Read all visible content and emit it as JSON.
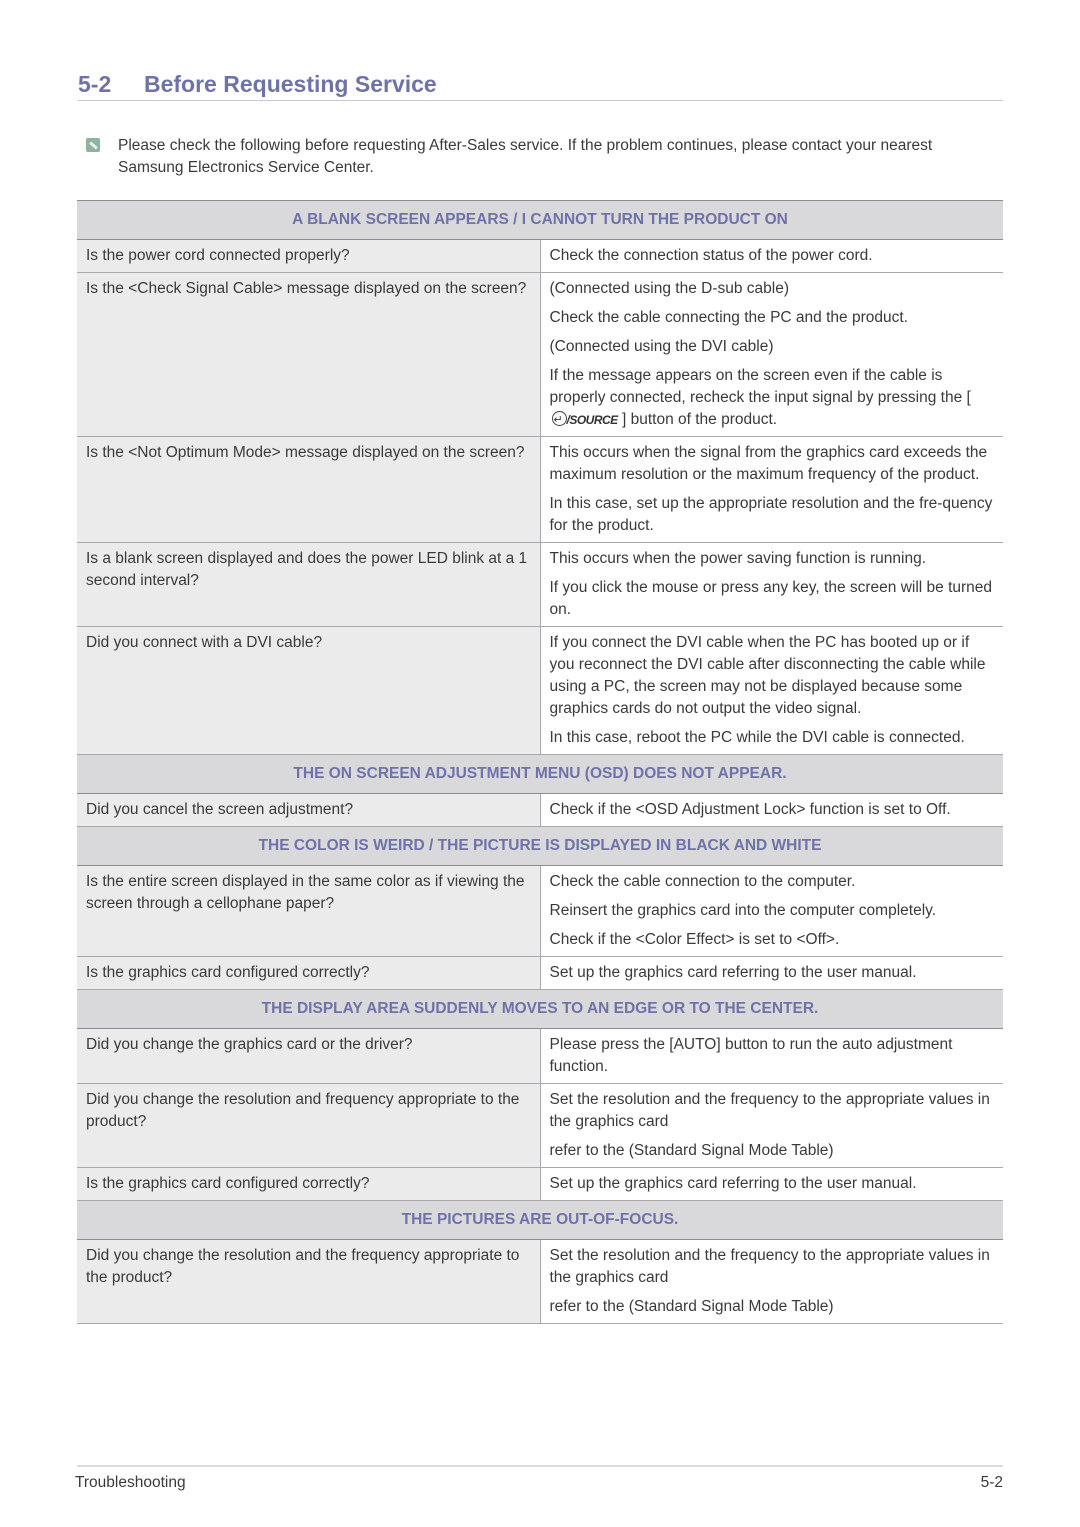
{
  "header": {
    "section_number": "5-2",
    "title": "Before Requesting Service"
  },
  "intro": {
    "icon": "note-icon",
    "text": "Please check the following before requesting After-Sales service. If the problem continues, please contact your nearest Samsung Electronics Service Center."
  },
  "sections": [
    {
      "title": "A BLANK SCREEN APPEARS / I CANNOT TURN THE PRODUCT ON",
      "rows": [
        {
          "question": "Is the power cord connected properly?",
          "answers": [
            "Check the connection status of the power cord."
          ]
        },
        {
          "question": "Is the <Check Signal Cable> message displayed on the screen?",
          "answers": [
            "(Connected using the D-sub cable)",
            "Check the cable connecting the PC and the product.",
            "(Connected using the DVI cable)",
            "If the message appears on the screen even if the cable is properly connected, recheck the input signal by pressing the ["
          ],
          "source_button_label": "/SOURCE",
          "answer_tail": " ] button of the product."
        },
        {
          "question": "Is the <Not Optimum Mode> message displayed on the screen?",
          "answers": [
            "This occurs when the signal from the graphics card exceeds the maximum resolution or the maximum frequency of the product.",
            "In this case, set up the appropriate resolution and the fre-quency for the product."
          ]
        },
        {
          "question": "Is a blank screen displayed and does the power LED blink at a 1 second interval?",
          "answers": [
            "This occurs when the power saving function is running.",
            "If you click the mouse or press any key, the screen will be turned on."
          ]
        },
        {
          "question": "Did you connect with a DVI cable?",
          "answers": [
            "If you connect the DVI cable when the PC has booted up or if you reconnect the DVI cable after disconnecting the cable while using a PC, the screen may not be displayed because some graphics cards do not output the video signal.",
            "In this case, reboot the PC while the DVI cable is connected."
          ]
        }
      ]
    },
    {
      "title": "THE ON SCREEN ADJUSTMENT MENU (OSD) DOES NOT APPEAR.",
      "rows": [
        {
          "question": "Did you cancel the screen adjustment?",
          "answers": [
            "Check if the <OSD Adjustment Lock> function is set to Off."
          ]
        }
      ]
    },
    {
      "title": "THE COLOR IS WEIRD / THE PICTURE IS DISPLAYED IN BLACK AND WHITE",
      "rows": [
        {
          "question": "Is the entire screen displayed in the same color as if viewing the screen through a cellophane paper?",
          "answers": [
            "Check the cable connection to the computer.",
            "Reinsert the graphics card into the computer completely.",
            "Check if the <Color Effect> is set to <Off>."
          ]
        },
        {
          "question": "Is the graphics card configured correctly?",
          "answers": [
            "Set up the graphics card referring to the user manual."
          ]
        }
      ]
    },
    {
      "title": "THE DISPLAY AREA SUDDENLY MOVES TO AN EDGE OR TO THE CENTER.",
      "rows": [
        {
          "question": "Did you change the graphics card or the driver?",
          "answers": [
            "Please press the [AUTO] button to run the auto adjustment function."
          ]
        },
        {
          "question": "Did you change the resolution and frequency appropriate to the product?",
          "answers": [
            "Set the resolution and the frequency to the appropriate values in the graphics card",
            "refer to the (Standard Signal Mode Table)"
          ]
        },
        {
          "question": "Is the graphics card configured correctly?",
          "answers": [
            "Set up the graphics card referring to the user manual."
          ]
        }
      ]
    },
    {
      "title": "THE PICTURES ARE OUT-OF-FOCUS.",
      "rows": [
        {
          "question": "Did you change the resolution and the frequency appropriate to the product?",
          "answers": [
            "Set the resolution and the frequency to the appropriate values in the graphics card",
            "refer to the (Standard Signal Mode Table)"
          ]
        }
      ]
    }
  ],
  "footer": {
    "chapter": "Troubleshooting",
    "page": "5-2"
  },
  "colors": {
    "accent": "#6f72a8",
    "header_bg": "#d9d9db",
    "question_bg": "#ebebeb"
  }
}
